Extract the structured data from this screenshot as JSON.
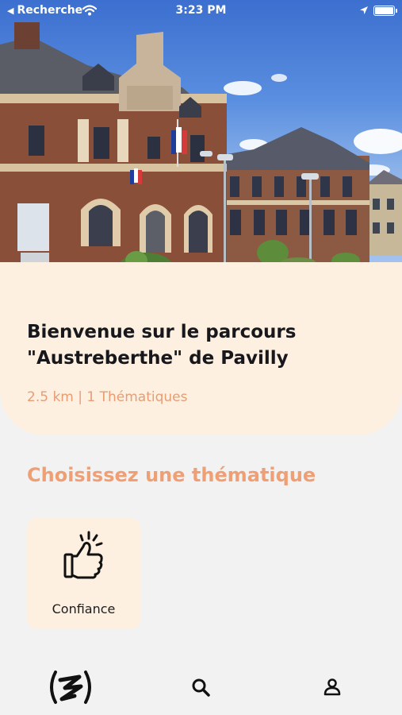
{
  "status_bar": {
    "back_label": "Recherche",
    "time": "3:23 PM"
  },
  "route": {
    "title": "Bienvenue sur le parcours \"Austreberthe\" de Pavilly",
    "meta": "2.5 km | 1 Thématiques"
  },
  "themes_section": {
    "heading": "Choisissez une thématique",
    "items": [
      {
        "label": "Confiance",
        "icon": "thumbs-up-icon"
      }
    ]
  },
  "tab_bar": {
    "items": [
      {
        "icon": "app-logo-icon"
      },
      {
        "icon": "search-icon"
      },
      {
        "icon": "profile-icon"
      }
    ]
  },
  "colors": {
    "accent": "#ef9f74",
    "card_background": "#fdf0e1",
    "page_background": "#f2f2f3"
  }
}
